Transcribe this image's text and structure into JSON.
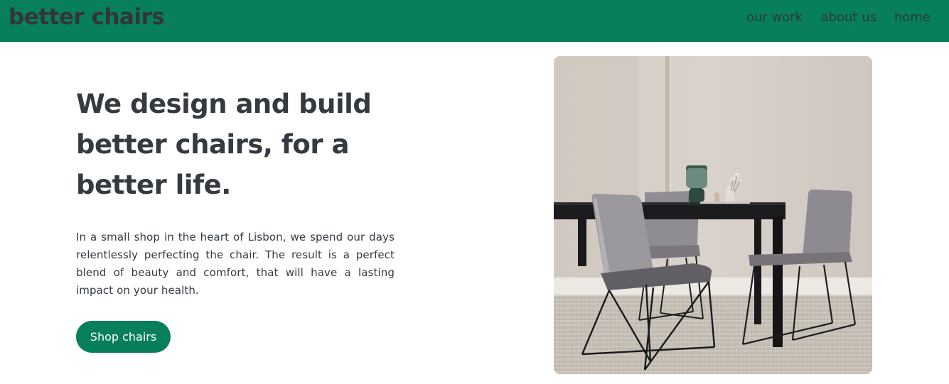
{
  "brand": {
    "name": "better chairs",
    "color": "#087f5b"
  },
  "nav": {
    "links": [
      {
        "label": "our work"
      },
      {
        "label": "about us"
      },
      {
        "label": "home"
      }
    ]
  },
  "hero": {
    "title": "We design and build better chairs, for a better life.",
    "description": "In a small shop in the heart of Lisbon, we spend our days relentlessly perfecting the chair. The result is a perfect blend of beauty and comfort, that will have a lasting impact on your health.",
    "cta_label": "Shop chairs",
    "image_subject": "dining-table-with-grey-chairs"
  }
}
